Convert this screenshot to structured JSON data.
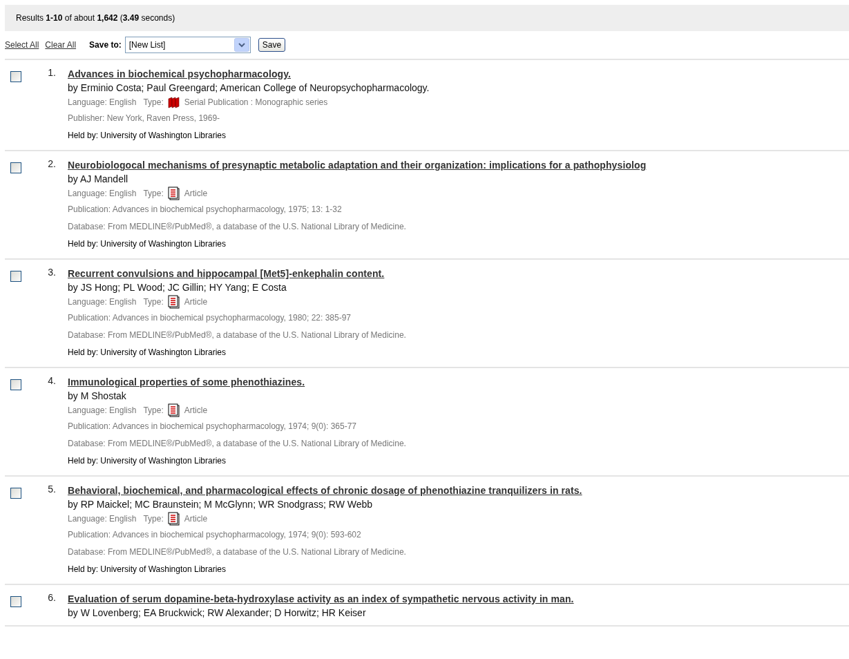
{
  "summary": "Results **1-10** of about **1,642** (**3.49** seconds)",
  "toolbar": {
    "links": [
      "Select All",
      "Clear All"
    ],
    "save_label": "Save to:",
    "save_list": "[New List]",
    "save_button": "Save"
  },
  "results": [
    {
      "number": "1.",
      "checked": false,
      "title": "Advances in biochemical psychopharmacology.",
      "authors": "by Erminio Costa; Paul Greengard; American College of Neuropsychopharmacology.",
      "language": "Language: English",
      "type_label": "Type:",
      "type": {
        "kind": "serial",
        "text": "Serial Publication : Monographic series"
      },
      "details": [
        "Publisher: New York, Raven Press, 1969-"
      ],
      "held_by": "Held by: University of Washington Libraries"
    },
    {
      "number": "2.",
      "checked": false,
      "title": "Neurobiologocal mechanisms of presynaptic metabolic adaptation and their organization: implications for a pathophysiolog",
      "authors": "by AJ Mandell",
      "language": "Language: English",
      "type_label": "Type:",
      "type": {
        "kind": "article",
        "text": "Article"
      },
      "details": [
        "Publication: Advances in biochemical psychopharmacology, 1975; 13: 1-32",
        "Database: From MEDLINE®/PubMed®, a database of the U.S. National Library of Medicine."
      ],
      "held_by": "Held by: University of Washington Libraries"
    },
    {
      "number": "3.",
      "checked": false,
      "title": "Recurrent convulsions and hippocampal [Met5]-enkephalin content.",
      "authors": "by JS Hong; PL Wood; JC Gillin; HY Yang; E Costa",
      "language": "Language: English",
      "type_label": "Type:",
      "type": {
        "kind": "article",
        "text": "Article"
      },
      "details": [
        "Publication: Advances in biochemical psychopharmacology, 1980; 22: 385-97",
        "Database: From MEDLINE®/PubMed®, a database of the U.S. National Library of Medicine."
      ],
      "held_by": "Held by: University of Washington Libraries"
    },
    {
      "number": "4.",
      "checked": false,
      "title": "Immunological properties of some phenothiazines.",
      "authors": "by M Shostak",
      "language": "Language: English",
      "type_label": "Type:",
      "type": {
        "kind": "article",
        "text": "Article"
      },
      "details": [
        "Publication: Advances in biochemical psychopharmacology, 1974; 9(0): 365-77",
        "Database: From MEDLINE®/PubMed®, a database of the U.S. National Library of Medicine."
      ],
      "held_by": "Held by: University of Washington Libraries"
    },
    {
      "number": "5.",
      "checked": false,
      "title": "Behavioral, biochemical, and pharmacological effects of chronic dosage of phenothiazine tranquilizers in rats.",
      "authors": "by RP Maickel; MC Braunstein; M McGlynn; WR Snodgrass; RW Webb",
      "language": "Language: English",
      "type_label": "Type:",
      "type": {
        "kind": "article",
        "text": "Article"
      },
      "details": [
        "Publication: Advances in biochemical psychopharmacology, 1974; 9(0): 593-602",
        "Database: From MEDLINE®/PubMed®, a database of the U.S. National Library of Medicine."
      ],
      "held_by": "Held by: University of Washington Libraries"
    },
    {
      "number": "6.",
      "checked": false,
      "title": "Evaluation of serum dopamine-beta-hydroxylase activity as an index of sympathetic nervous activity in man.",
      "authors": "by W Lovenberg; EA Bruckwick; RW Alexander; D Horwitz; HR Keiser"
    }
  ]
}
